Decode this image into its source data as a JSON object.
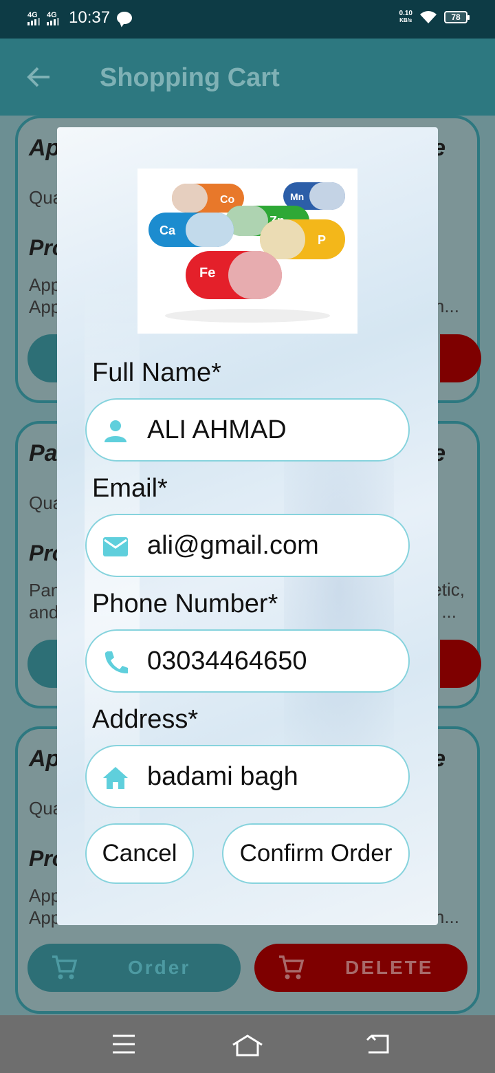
{
  "status_bar": {
    "network_1": "4G",
    "network_2": "4G",
    "time": "10:37",
    "speed_value": "0.10",
    "speed_unit": "KB/s",
    "battery": "78"
  },
  "app_bar": {
    "title": "Shopping Cart"
  },
  "background_cards": [
    {
      "title": "Ap",
      "quantity": "Qua",
      "product_heading": "Pro",
      "description_1": "App",
      "description_2": "App",
      "trailing_title": "e",
      "trailing_desc": "h..."
    },
    {
      "title": "Pa",
      "quantity": "Qua",
      "product_heading": "Pro",
      "description_1": "Pan",
      "description_2": "and",
      "trailing_title": "e",
      "trailing_desc_1": "etic,",
      "trailing_desc_2": "..."
    },
    {
      "title": "Ap",
      "quantity": "Qua",
      "product_heading": "Pro",
      "description_1": "App",
      "description_2": "App",
      "trailing_title": "e",
      "trailing_desc": "h...",
      "order_label": "Order",
      "delete_label": "DELETE"
    }
  ],
  "dialog": {
    "full_name_label": "Full Name*",
    "full_name_value": "ALI AHMAD",
    "email_label": "Email*",
    "email_value": "ali@gmail.com",
    "phone_label": "Phone Number*",
    "phone_value": "03034464650",
    "address_label": "Address*",
    "address_value": "badami bagh",
    "cancel_label": "Cancel",
    "confirm_label": "Confirm Order",
    "capsule_labels": [
      "Ca",
      "Co",
      "Mn",
      "Zn",
      "P",
      "Fe"
    ]
  },
  "colors": {
    "status_bar": "#0d3b45",
    "app_bar": "#2d7880",
    "field_border": "#86d3dd",
    "field_icon": "#5fcfdc",
    "delete_red": "#7e0000"
  }
}
